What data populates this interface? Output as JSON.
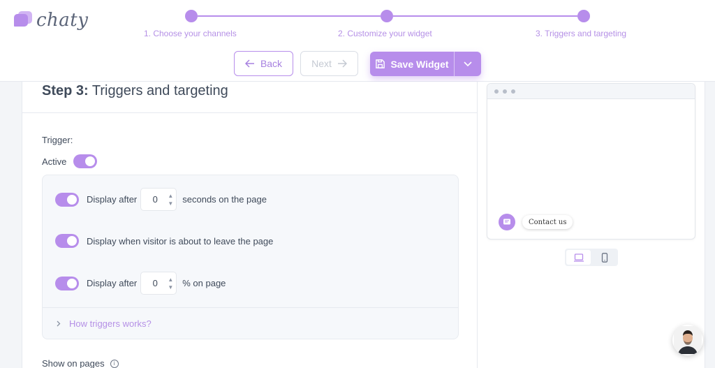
{
  "app": {
    "logo_text": "chaty"
  },
  "stepper": {
    "steps": [
      {
        "label": "1. Choose your channels"
      },
      {
        "label": "2. Customize your widget"
      },
      {
        "label": "3. Triggers and targeting"
      }
    ]
  },
  "toolbar": {
    "back_label": "Back",
    "next_label": "Next",
    "save_label": "Save Widget"
  },
  "main": {
    "title_bold": "Step 3:",
    "title_rest": " Triggers and targeting",
    "trigger_label": "Trigger:",
    "active_label": "Active",
    "triggers": {
      "time": {
        "prefix": "Display after",
        "value": "0",
        "suffix": "seconds on the page",
        "enabled": true
      },
      "exit": {
        "label": "Display when visitor is about to leave the page",
        "enabled": true
      },
      "scroll": {
        "prefix": "Display after",
        "value": "0",
        "suffix": "% on page",
        "enabled": true
      }
    },
    "how_link": "How triggers works?",
    "show_on_pages": "Show on pages"
  },
  "preview": {
    "contact_label": "Contact us",
    "devices": [
      "desktop-icon",
      "mobile-icon"
    ]
  },
  "colors": {
    "accent": "#b78deb",
    "accent_text": "#b590e6",
    "text": "#3f4a5a",
    "panel_bg": "#f6f8fb"
  }
}
